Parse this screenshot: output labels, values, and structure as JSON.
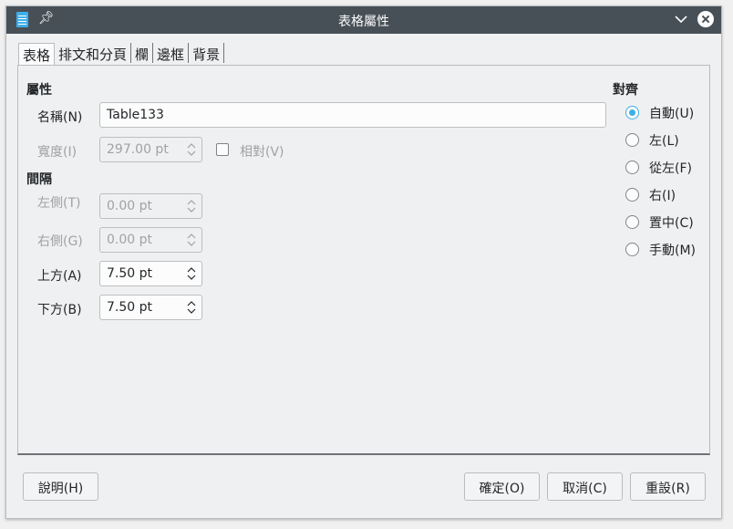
{
  "window": {
    "title": "表格屬性"
  },
  "tabs": [
    {
      "label": "表格"
    },
    {
      "label": "排文和分頁"
    },
    {
      "label": "欄"
    },
    {
      "label": "邊框"
    },
    {
      "label": "背景"
    }
  ],
  "properties": {
    "heading": "屬性",
    "name_label": "名稱(N)",
    "name_value": "Table133",
    "width_label": "寬度(I)",
    "width_value": "297.00 pt",
    "relative_label": "相對(V)"
  },
  "spacing": {
    "heading": "間隔",
    "left_label": "左側(T)",
    "left_value": "0.00 pt",
    "right_label": "右側(G)",
    "right_value": "0.00 pt",
    "above_label": "上方(A)",
    "above_value": "7.50 pt",
    "below_label": "下方(B)",
    "below_value": "7.50 pt"
  },
  "alignment": {
    "heading": "對齊",
    "options": [
      {
        "label": "自動(U)",
        "checked": true
      },
      {
        "label": "左(L)",
        "checked": false
      },
      {
        "label": "從左(F)",
        "checked": false
      },
      {
        "label": "右(I)",
        "checked": false
      },
      {
        "label": "置中(C)",
        "checked": false
      },
      {
        "label": "手動(M)",
        "checked": false
      }
    ]
  },
  "buttons": {
    "help": "說明(H)",
    "ok": "確定(O)",
    "cancel": "取消(C)",
    "reset": "重設(R)"
  },
  "colors": {
    "accent": "#3daee9",
    "titlebar": "#475057"
  }
}
